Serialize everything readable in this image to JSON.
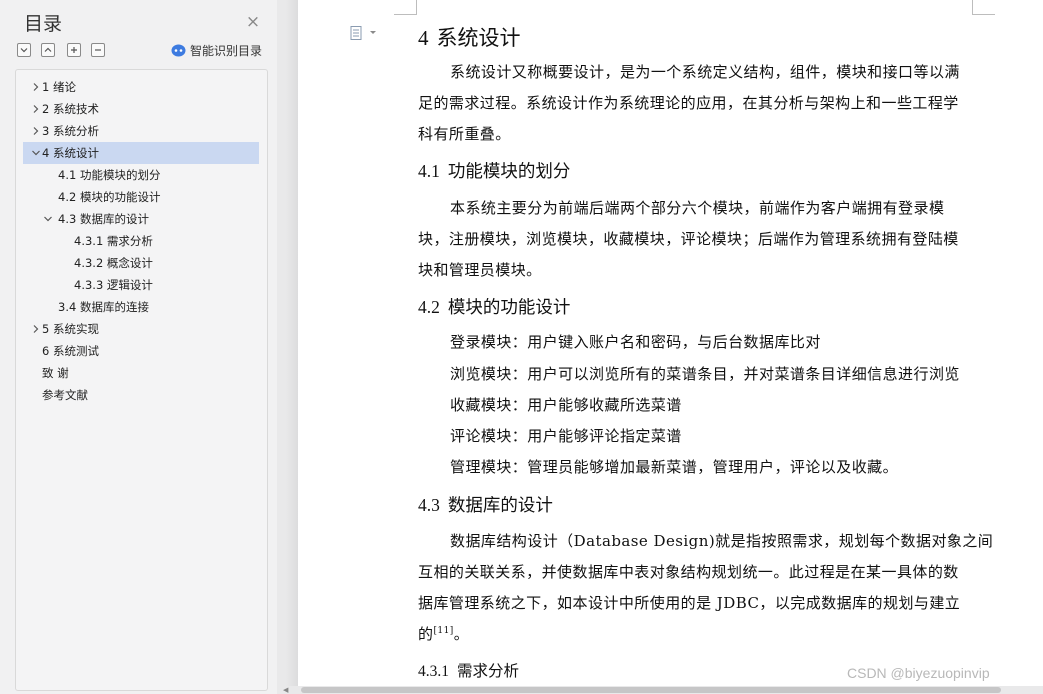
{
  "nav": {
    "title": "目录",
    "close_icon": "×",
    "smart_toc_label": "智能识别目录",
    "tools": [
      "expand-all-icon",
      "collapse-all-icon",
      "add-level-icon",
      "remove-level-icon"
    ],
    "toc": [
      {
        "label": "1 绪论",
        "level": 1,
        "chevron": "right",
        "selected": false
      },
      {
        "label": "2 系统技术",
        "level": 1,
        "chevron": "right",
        "selected": false
      },
      {
        "label": "3 系统分析",
        "level": 1,
        "chevron": "right",
        "selected": false
      },
      {
        "label": "4 系统设计",
        "level": 1,
        "chevron": "down",
        "selected": true
      },
      {
        "label": "4.1  功能模块的划分",
        "level": 2,
        "chevron": "none",
        "selected": false
      },
      {
        "label": "4.2  模块的功能设计",
        "level": 2,
        "chevron": "none",
        "selected": false
      },
      {
        "label": "4.3  数据库的设计",
        "level": 2,
        "chevron": "down",
        "selected": false
      },
      {
        "label": "4.3.1  需求分析",
        "level": 3,
        "chevron": "none",
        "selected": false
      },
      {
        "label": "4.3.2  概念设计",
        "level": 3,
        "chevron": "none",
        "selected": false
      },
      {
        "label": "4.3.3  逻辑设计",
        "level": 3,
        "chevron": "none",
        "selected": false
      },
      {
        "label": "3.4  数据库的连接",
        "level": 2,
        "chevron": "none",
        "selected": false
      },
      {
        "label": "5 系统实现",
        "level": 1,
        "chevron": "right",
        "selected": false
      },
      {
        "label": "6 系统测试",
        "level": 1,
        "chevron": "none",
        "selected": false
      },
      {
        "label": "致    谢",
        "level": 1,
        "chevron": "none",
        "selected": false
      },
      {
        "label": "参考文献",
        "level": 1,
        "chevron": "none",
        "selected": false
      }
    ]
  },
  "doc": {
    "h1": {
      "num": "4",
      "text": "系统设计"
    },
    "p1": [
      "系统设计又称概要设计，是为一个系统定义结构，组件，模块和接口等以满",
      "足的需求过程。系统设计作为系统理论的应用，在其分析与架构上和一些工程学",
      "科有所重叠。"
    ],
    "h2_1": {
      "num": "4.1",
      "text": "功能模块的划分"
    },
    "p2": [
      "本系统主要分为前端后端两个部分六个模块，前端作为客户端拥有登录模",
      "块，注册模块，浏览模块，收藏模块，评论模块；后端作为管理系统拥有登陆模",
      "块和管理员模块。"
    ],
    "h2_2": {
      "num": "4.2",
      "text": "模块的功能设计"
    },
    "modules": [
      "登录模块：用户键入账户名和密码，与后台数据库比对",
      "浏览模块：用户可以浏览所有的菜谱条目，并对菜谱条目详细信息进行浏览",
      "收藏模块：用户能够收藏所选菜谱",
      "评论模块：用户能够评论指定菜谱",
      "管理模块：管理员能够增加最新菜谱，管理用户，评论以及收藏。"
    ],
    "h2_3": {
      "num": "4.3",
      "text": "数据库的设计"
    },
    "p3": [
      "数据库结构设计（Database Design)就是指按照需求，规划每个数据对象之间",
      "互相的关联关系，并使数据库中表对象结构规划统一。此过程是在某一具体的数",
      "据库管理系统之下，如本设计中所使用的是 JDBC，以完成数据库的规划与建立"
    ],
    "p3_last": "的",
    "p3_ref": "[11]",
    "p3_end": "。",
    "h3_1": {
      "num": "4.3.1",
      "text": "需求分析"
    }
  },
  "watermark": "CSDN @biyezuopinvip",
  "colors": {
    "selected_bg": "#cad8f1",
    "ai_icon": "#3d7be0"
  }
}
